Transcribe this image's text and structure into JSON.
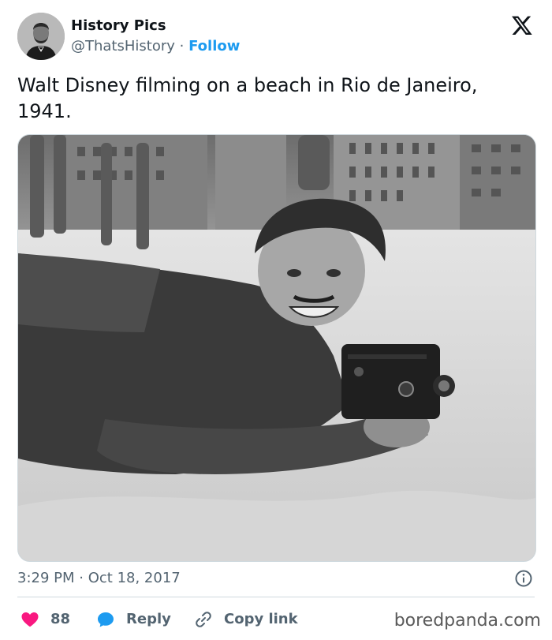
{
  "author": {
    "display_name": "History Pics",
    "handle": "@ThatsHistory",
    "separator": "·",
    "follow_label": "Follow",
    "avatar_icon": "portrait-avatar"
  },
  "tweet": {
    "text": "Walt Disney filming on a beach in Rio de Janeiro, 1941.",
    "time": "3:29 PM",
    "date_separator": "·",
    "date": "Oct 18, 2017"
  },
  "actions": {
    "likes_count": "88",
    "reply_label": "Reply",
    "copy_link_label": "Copy link"
  },
  "icons": {
    "brand": "x-logo-icon",
    "info": "info-icon",
    "like": "heart-icon",
    "reply": "speech-bubble-icon",
    "link": "link-icon"
  },
  "colors": {
    "accent": "#1d9bf0",
    "heart": "#f91880",
    "secondary_text": "#536471"
  },
  "watermark": "boredpanda.com"
}
